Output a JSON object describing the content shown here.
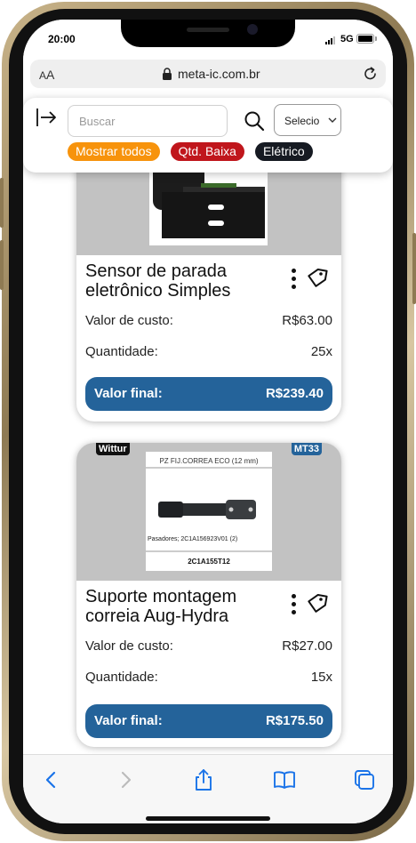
{
  "status": {
    "time": "20:00",
    "network": "5G"
  },
  "browser": {
    "text_size_label_small": "A",
    "text_size_label_large": "A",
    "url": "meta-ic.com.br"
  },
  "filters": {
    "search_placeholder": "Buscar",
    "select_value": "Selecio",
    "chips": [
      {
        "label": "Mostrar todos",
        "color": "#f7930c"
      },
      {
        "label": "Qtd. Baixa",
        "color": "#c0161c"
      },
      {
        "label": "Elétrico",
        "color": "#161a22"
      }
    ]
  },
  "products": [
    {
      "title": "Sensor de parada eletrônico Simples",
      "cost_label": "Valor de custo:",
      "cost_value": "R$63.00",
      "qty_label": "Quantidade:",
      "qty_value": "25x",
      "final_label": "Valor final:",
      "final_value": "R$239.40"
    },
    {
      "brand_badge": "Wittur",
      "code_badge": "MT33",
      "image_header": "PZ FIJ.CORREA ECO  (12 mm)",
      "image_caption": "Pasadores; 2C1A156923V01 (2)",
      "image_footer": "2C1A155T12",
      "title": "Suporte montagem correia Aug-Hydra",
      "cost_label": "Valor de custo:",
      "cost_value": "R$27.00",
      "qty_label": "Quantidade:",
      "qty_value": "15x",
      "final_label": "Valor final:",
      "final_value": "R$175.50"
    }
  ],
  "colors": {
    "accent": "#24639a",
    "ios_blue": "#1a73e8",
    "badge_dark": "#111111",
    "badge_blue": "#24639a"
  },
  "toolbar": {
    "icons": [
      "back-icon",
      "forward-icon",
      "share-icon",
      "bookmarks-icon",
      "tabs-icon"
    ]
  }
}
